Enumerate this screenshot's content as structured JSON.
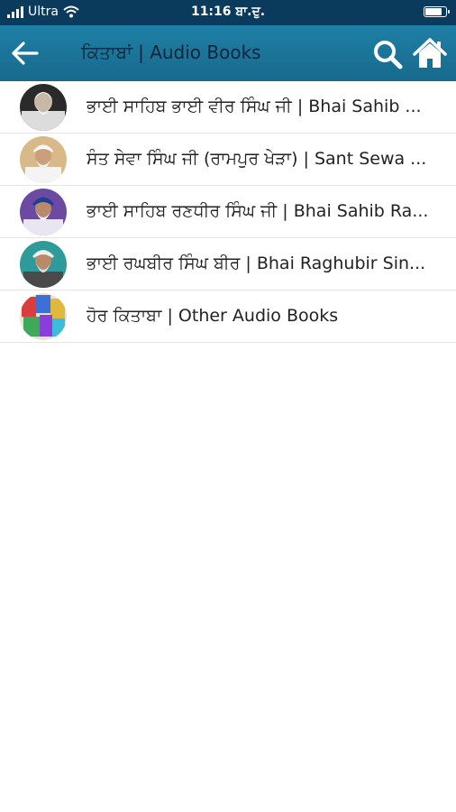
{
  "status_bar": {
    "carrier": "Ultra",
    "time": "11:16 ਬਾ.ਦੁ.",
    "battery_level": 0.85
  },
  "app_bar": {
    "title": "ਕਿਤਾਬਾਂ | Audio Books",
    "icons": [
      "back-arrow-icon",
      "search-icon",
      "home-icon"
    ],
    "color": "#1a74a0"
  },
  "list": {
    "items": [
      {
        "label": "ਭਾਈ ਸਾਹਿਬ ਭਾਈ ਵੀਰ ਸਿੰਘ ਜੀ | Bhai Sahib ...",
        "avatar": "portrait-bhai-vir-singh"
      },
      {
        "label": "ਸੰਤ ਸੇਵਾ ਸਿੰਘ ਜੀ (ਰਾਮਪੁਰ ਖੇੜਾ) | Sant Sewa ...",
        "avatar": "portrait-sant-sewa-singh"
      },
      {
        "label": "ਭਾਈ ਸਾਹਿਬ ਰਣਧੀਰ ਸਿੰਘ ਜੀ | Bhai Sahib Ra...",
        "avatar": "portrait-bhai-randhir-singh"
      },
      {
        "label": "ਭਾਈ ਰਘਬੀਰ ਸਿੰਘ ਬੀਰ | Bhai Raghubir Sin...",
        "avatar": "portrait-bhai-raghubir-singh"
      },
      {
        "label": "ਹੋਰ ਕਿਤਾਬਾ | Other Audio Books",
        "avatar": "books-collage"
      }
    ]
  }
}
